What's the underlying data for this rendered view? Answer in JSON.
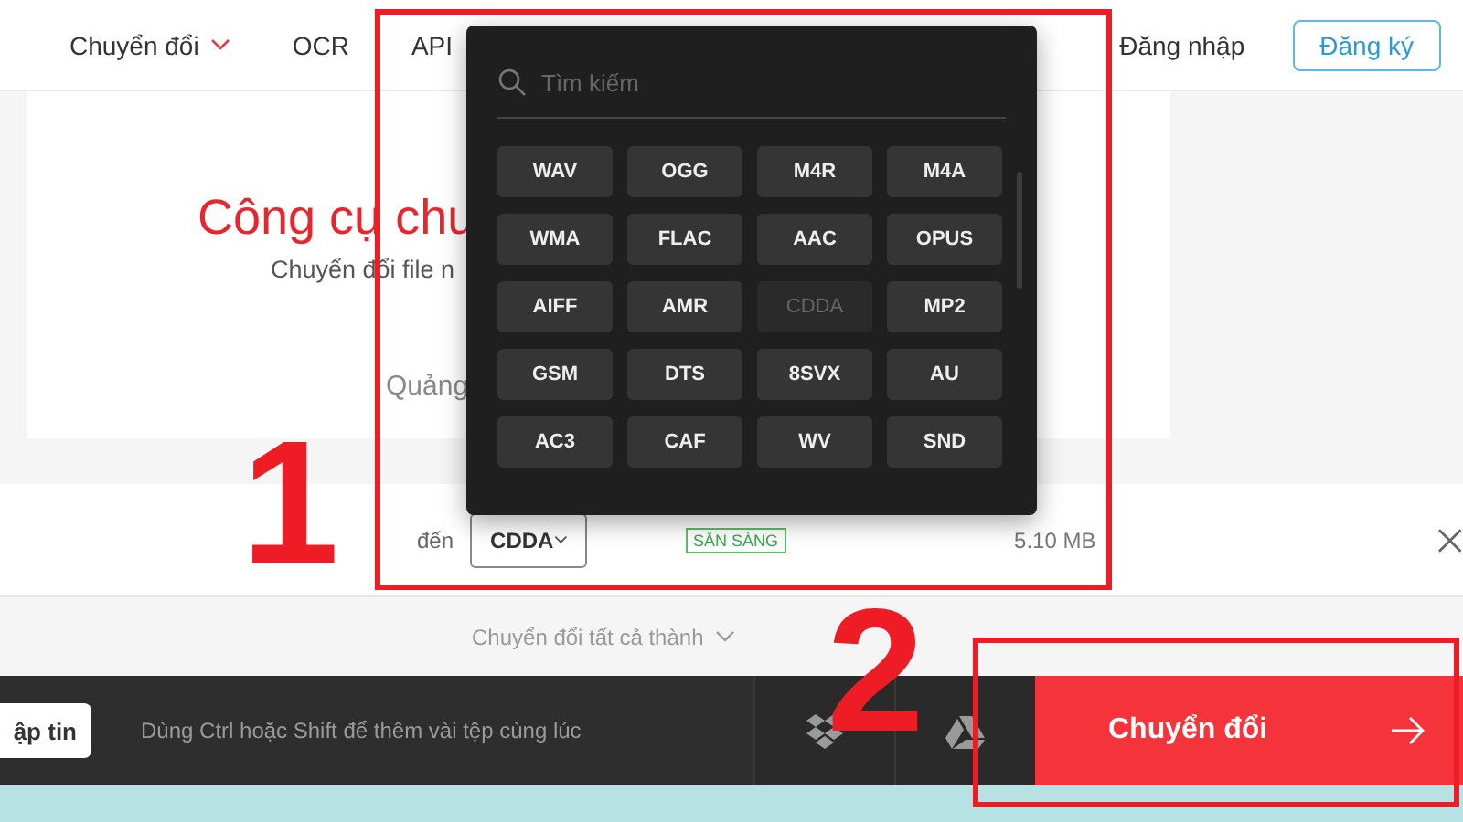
{
  "header": {
    "nav": [
      {
        "label": "Chuyển đổi",
        "dropdown": true
      },
      {
        "label": "OCR",
        "dropdown": false
      },
      {
        "label": "API",
        "dropdown": false
      }
    ],
    "login": "Đăng nhập",
    "signup": "Đăng ký"
  },
  "hero": {
    "title": "Công cụ chu",
    "subtitle": "Chuyển đổi file n",
    "ad": "Quảng"
  },
  "file_row": {
    "to_label": "đến",
    "format": "CDDA",
    "status": "SẴN SÀNG",
    "size": "5.10 MB"
  },
  "format_menu": {
    "search": {
      "placeholder": "Tìm kiếm"
    },
    "formats": [
      {
        "label": "WAV",
        "selected": false
      },
      {
        "label": "OGG",
        "selected": false
      },
      {
        "label": "M4R",
        "selected": false
      },
      {
        "label": "M4A",
        "selected": false
      },
      {
        "label": "WMA",
        "selected": false
      },
      {
        "label": "FLAC",
        "selected": false
      },
      {
        "label": "AAC",
        "selected": false
      },
      {
        "label": "OPUS",
        "selected": false
      },
      {
        "label": "AIFF",
        "selected": false
      },
      {
        "label": "AMR",
        "selected": false
      },
      {
        "label": "CDDA",
        "selected": true
      },
      {
        "label": "MP2",
        "selected": false
      },
      {
        "label": "GSM",
        "selected": false
      },
      {
        "label": "DTS",
        "selected": false
      },
      {
        "label": "8SVX",
        "selected": false
      },
      {
        "label": "AU",
        "selected": false
      },
      {
        "label": "AC3",
        "selected": false
      },
      {
        "label": "CAF",
        "selected": false
      },
      {
        "label": "WV",
        "selected": false
      },
      {
        "label": "SND",
        "selected": false
      }
    ]
  },
  "convert_all": "Chuyển đổi tất cả thành",
  "footer_bar": {
    "add_button": "ập tin",
    "hint": "Dùng Ctrl hoặc Shift để thêm vài tệp cùng lúc",
    "convert_button": "Chuyển đổi"
  },
  "annotations": [
    {
      "label": "1"
    },
    {
      "label": "2"
    }
  ]
}
